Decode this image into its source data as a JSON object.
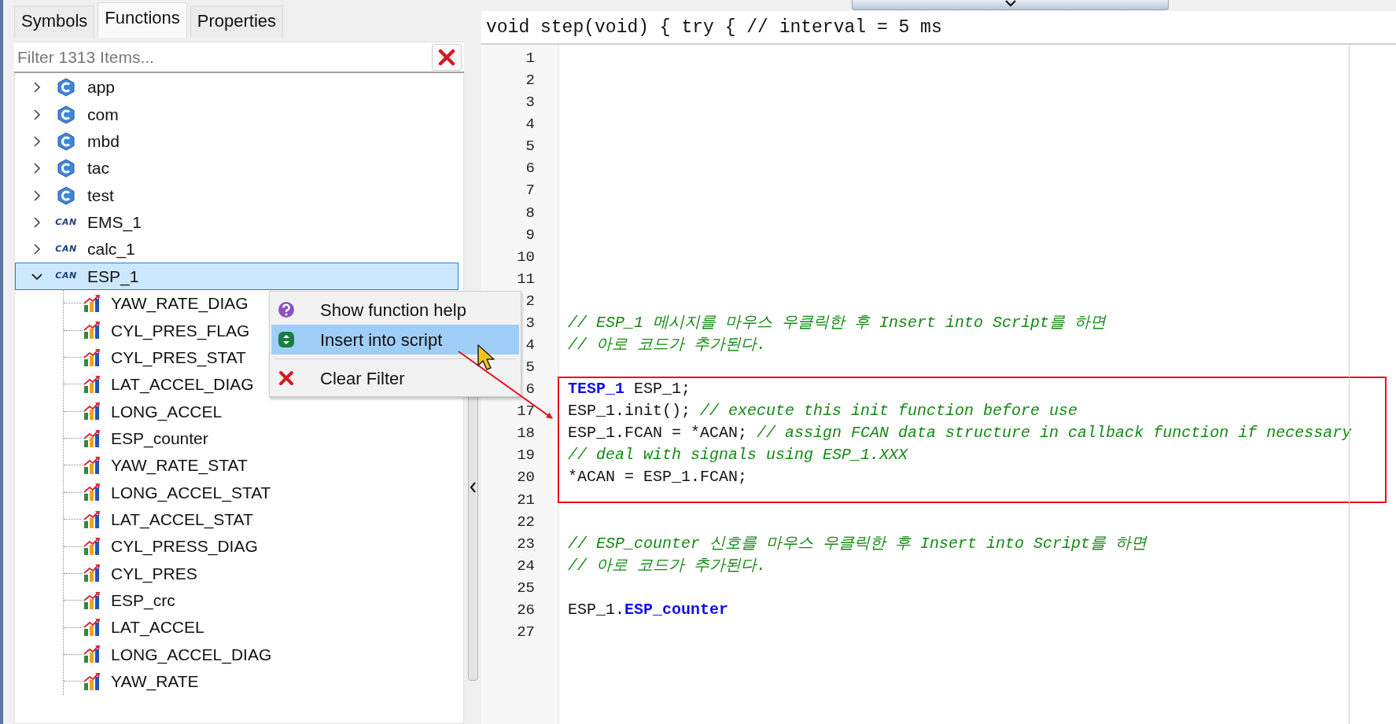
{
  "tabs": [
    {
      "label": "Symbols",
      "selected": false
    },
    {
      "label": "Functions",
      "selected": true
    },
    {
      "label": "Properties",
      "selected": false
    }
  ],
  "filter": {
    "placeholder": "Filter 1313 Items..."
  },
  "tree": [
    {
      "label": "app",
      "kind": "module",
      "expanded": false,
      "selected": false
    },
    {
      "label": "com",
      "kind": "module",
      "expanded": false,
      "selected": false
    },
    {
      "label": "mbd",
      "kind": "module",
      "expanded": false,
      "selected": false
    },
    {
      "label": "tac",
      "kind": "module",
      "expanded": false,
      "selected": false
    },
    {
      "label": "test",
      "kind": "module",
      "expanded": false,
      "selected": false
    },
    {
      "label": "EMS_1",
      "kind": "can",
      "badge": "CAN",
      "expanded": false,
      "selected": false
    },
    {
      "label": "calc_1",
      "kind": "can",
      "badge": "CAN",
      "expanded": false,
      "selected": false
    },
    {
      "label": "ESP_1",
      "kind": "can",
      "badge": "CAN",
      "expanded": true,
      "selected": true,
      "children": [
        {
          "label": "YAW_RATE_DIAG",
          "kind": "signal",
          "selected": false
        },
        {
          "label": "CYL_PRES_FLAG",
          "kind": "signal",
          "selected": false
        },
        {
          "label": "CYL_PRES_STAT",
          "kind": "signal",
          "selected": false
        },
        {
          "label": "LAT_ACCEL_DIAG",
          "kind": "signal",
          "selected": false
        },
        {
          "label": "LONG_ACCEL",
          "kind": "signal",
          "selected": false
        },
        {
          "label": "ESP_counter",
          "kind": "signal",
          "selected": false
        },
        {
          "label": "YAW_RATE_STAT",
          "kind": "signal",
          "selected": false
        },
        {
          "label": "LONG_ACCEL_STAT",
          "kind": "signal",
          "selected": false
        },
        {
          "label": "LAT_ACCEL_STAT",
          "kind": "signal",
          "selected": false
        },
        {
          "label": "CYL_PRESS_DIAG",
          "kind": "signal",
          "selected": false
        },
        {
          "label": "CYL_PRES",
          "kind": "signal",
          "selected": false
        },
        {
          "label": "ESP_crc",
          "kind": "signal",
          "selected": false
        },
        {
          "label": "LAT_ACCEL",
          "kind": "signal",
          "selected": false
        },
        {
          "label": "LONG_ACCEL_DIAG",
          "kind": "signal",
          "selected": false
        },
        {
          "label": "YAW_RATE",
          "kind": "signal",
          "selected": false
        }
      ]
    }
  ],
  "context_menu": {
    "groups": [
      {
        "items": [
          {
            "label": "Show function help",
            "kind": "help",
            "selected": false
          },
          {
            "label": "Insert into script",
            "kind": "insert",
            "selected": true
          }
        ]
      },
      {
        "items": [
          {
            "label": "Clear Filter",
            "kind": "clear",
            "selected": false
          }
        ]
      }
    ]
  },
  "editor": {
    "header": "void step(void) { try { // interval = 5 ms",
    "lines": [
      {
        "number": "1",
        "highlighted": false
      },
      {
        "number": "2",
        "highlighted": false
      },
      {
        "number": "3",
        "highlighted": false
      },
      {
        "number": "4",
        "highlighted": false
      },
      {
        "number": "5",
        "highlighted": false
      },
      {
        "number": "6",
        "highlighted": false
      },
      {
        "number": "7",
        "highlighted": false
      },
      {
        "number": "8",
        "highlighted": false
      },
      {
        "number": "9",
        "highlighted": false
      },
      {
        "number": "10",
        "highlighted": false
      },
      {
        "number": "11",
        "highlighted": false
      },
      {
        "number": "2",
        "highlighted": false
      },
      {
        "number": "3",
        "highlighted": false,
        "segments": [
          {
            "kind": "comment",
            "text": "// ESP_1 메시지를 마우스 우클릭한 후 Insert into Script를 하면"
          }
        ]
      },
      {
        "number": "4",
        "highlighted": false,
        "segments": [
          {
            "kind": "comment",
            "text": "// 아로 코드가 추가된다."
          }
        ]
      },
      {
        "number": "5",
        "highlighted": false
      },
      {
        "number": "6",
        "highlighted": true,
        "segments": [
          {
            "kind": "type",
            "text": "TESP_1"
          },
          {
            "kind": "plain",
            "text": " ESP_1;"
          }
        ]
      },
      {
        "number": "17",
        "highlighted": true,
        "segments": [
          {
            "kind": "plain",
            "text": "ESP_1.init(); "
          },
          {
            "kind": "comment",
            "text": "// execute this init function before use"
          }
        ]
      },
      {
        "number": "18",
        "highlighted": true,
        "segments": [
          {
            "kind": "plain",
            "text": "ESP_1.FCAN = *ACAN; "
          },
          {
            "kind": "comment",
            "text": "// assign FCAN data structure in callback function if necessary"
          }
        ]
      },
      {
        "number": "19",
        "highlighted": true,
        "segments": [
          {
            "kind": "comment",
            "text": "// deal with signals using ESP_1.XXX"
          }
        ]
      },
      {
        "number": "20",
        "highlighted": true,
        "segments": [
          {
            "kind": "plain",
            "text": "*ACAN = ESP_1.FCAN;"
          }
        ]
      },
      {
        "number": "21",
        "highlighted": false
      },
      {
        "number": "22",
        "highlighted": false
      },
      {
        "number": "23",
        "highlighted": false,
        "segments": [
          {
            "kind": "comment",
            "text": "// ESP_counter 신호를 마우스 우클릭한 후 Insert into Script를 하면"
          }
        ]
      },
      {
        "number": "24",
        "highlighted": false,
        "segments": [
          {
            "kind": "comment",
            "text": "// 아로 코드가 추가된다."
          }
        ]
      },
      {
        "number": "25",
        "highlighted": false
      },
      {
        "number": "26",
        "highlighted": false,
        "segments": [
          {
            "kind": "plain",
            "text": "ESP_1."
          },
          {
            "kind": "member",
            "text": "ESP_counter"
          }
        ]
      },
      {
        "number": "27",
        "highlighted": false
      }
    ]
  }
}
